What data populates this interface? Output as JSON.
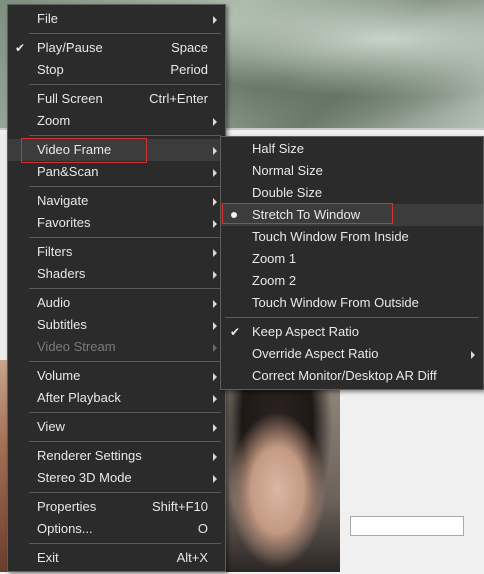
{
  "main_menu": {
    "items": [
      {
        "label": "File",
        "submenu": true
      },
      {
        "sep": true
      },
      {
        "label": "Play/Pause",
        "shortcut": "Space",
        "checked": true
      },
      {
        "label": "Stop",
        "shortcut": "Period"
      },
      {
        "sep": true
      },
      {
        "label": "Full Screen",
        "shortcut": "Ctrl+Enter"
      },
      {
        "label": "Zoom",
        "submenu": true
      },
      {
        "sep": true
      },
      {
        "label": "Video Frame",
        "submenu": true,
        "active": true,
        "highlighted": true
      },
      {
        "label": "Pan&Scan",
        "submenu": true
      },
      {
        "sep": true
      },
      {
        "label": "Navigate",
        "submenu": true
      },
      {
        "label": "Favorites",
        "submenu": true
      },
      {
        "sep": true
      },
      {
        "label": "Filters",
        "submenu": true
      },
      {
        "label": "Shaders",
        "submenu": true
      },
      {
        "sep": true
      },
      {
        "label": "Audio",
        "submenu": true
      },
      {
        "label": "Subtitles",
        "submenu": true
      },
      {
        "label": "Video Stream",
        "submenu": true,
        "disabled": true
      },
      {
        "sep": true
      },
      {
        "label": "Volume",
        "submenu": true
      },
      {
        "label": "After Playback",
        "submenu": true
      },
      {
        "sep": true
      },
      {
        "label": "View",
        "submenu": true
      },
      {
        "sep": true
      },
      {
        "label": "Renderer Settings",
        "submenu": true
      },
      {
        "label": "Stereo 3D Mode",
        "submenu": true
      },
      {
        "sep": true
      },
      {
        "label": "Properties",
        "shortcut": "Shift+F10"
      },
      {
        "label": "Options...",
        "shortcut": "O"
      },
      {
        "sep": true
      },
      {
        "label": "Exit",
        "shortcut": "Alt+X"
      }
    ]
  },
  "video_frame_submenu": {
    "items": [
      {
        "label": "Half Size"
      },
      {
        "label": "Normal Size"
      },
      {
        "label": "Double Size"
      },
      {
        "label": "Stretch To Window",
        "radio": true,
        "active": true,
        "highlighted": true
      },
      {
        "label": "Touch Window From Inside"
      },
      {
        "label": "Zoom 1"
      },
      {
        "label": "Zoom 2"
      },
      {
        "label": "Touch Window From Outside"
      },
      {
        "sep": true
      },
      {
        "label": "Keep Aspect Ratio",
        "checked": true
      },
      {
        "label": "Override Aspect Ratio",
        "submenu": true
      },
      {
        "label": "Correct Monitor/Desktop AR Diff"
      }
    ]
  },
  "colors": {
    "menu_bg": "#2b2b2b",
    "menu_text": "#e8e8e8",
    "disabled_text": "#7a7a7a",
    "highlight_box": "#d23232"
  },
  "icons": {
    "check": "check-icon",
    "radio": "radio-dot-icon",
    "submenu": "submenu-arrow-icon"
  }
}
